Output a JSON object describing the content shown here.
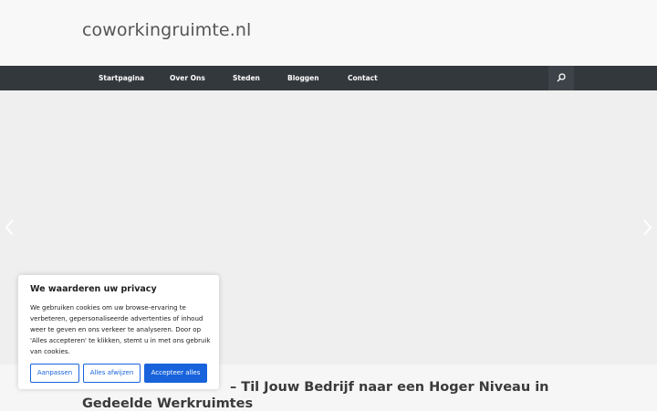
{
  "header": {
    "site_title": "coworkingruimte.nl"
  },
  "nav": {
    "items": [
      {
        "label": "Startpagina"
      },
      {
        "label": "Over Ons"
      },
      {
        "label": "Steden"
      },
      {
        "label": "Bloggen"
      },
      {
        "label": "Contact"
      }
    ],
    "search_icon": "search-icon"
  },
  "hero": {
    "prev_icon": "chevron-left-icon",
    "next_icon": "chevron-right-icon"
  },
  "article": {
    "title": "– Til Jouw Bedrijf naar een Hoger Niveau in Gedeelde Werkruimtes"
  },
  "cookie": {
    "title": "We waarderen uw privacy",
    "text": "We gebruiken cookies om uw browse-ervaring te verbeteren, gepersonaliseerde advertenties of inhoud weer te geven en ons verkeer te analyseren. Door op 'Alles accepteren' te klikken, stemt u in met ons gebruik van cookies.",
    "buttons": {
      "customize": "Aanpassen",
      "reject": "Alles afwijzen",
      "accept": "Accepteer alles"
    },
    "accent": "#1863dc"
  },
  "colors": {
    "nav_bg": "#33383d",
    "header_bg": "#f8f8f8",
    "hero_bg": "#efefef"
  }
}
